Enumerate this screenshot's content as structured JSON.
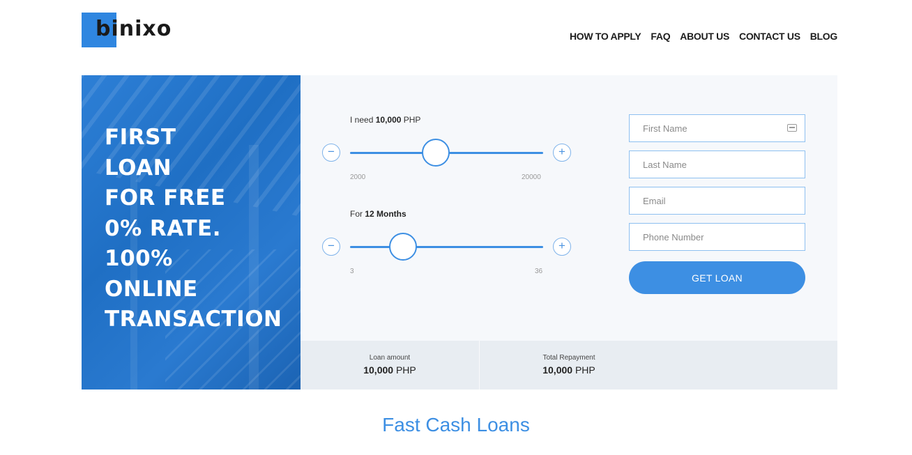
{
  "brand": {
    "logo_text": "binixo",
    "accent_color": "#2f86e0"
  },
  "nav": {
    "items": [
      "HOW TO APPLY",
      "FAQ",
      "ABOUT US",
      "CONTACT US",
      "BLOG"
    ]
  },
  "promo": {
    "lines": [
      "FIRST",
      "LOAN",
      "FOR FREE",
      "0% RATE.",
      "100%",
      "ONLINE",
      "TRANSACTION"
    ]
  },
  "amount_slider": {
    "label_prefix": "I need",
    "value_text": "10,000",
    "unit": "PHP",
    "min": "2000",
    "max": "20000",
    "value": 10000,
    "minus_icon": "minus-icon",
    "plus_icon": "plus-icon"
  },
  "term_slider": {
    "label_prefix": "For",
    "value_text": "12 Months",
    "min": "3",
    "max": "36",
    "value": 12,
    "minus_icon": "minus-icon",
    "plus_icon": "plus-icon"
  },
  "form": {
    "first_name_placeholder": "First Name",
    "last_name_placeholder": "Last Name",
    "email_placeholder": "Email",
    "phone_placeholder": "Phone Number",
    "submit_label": "GET LOAN",
    "field_icon": "id-card-icon"
  },
  "summary": {
    "loan_amount_label": "Loan amount",
    "loan_amount_value": "10,000",
    "loan_amount_unit": "PHP",
    "total_repayment_label": "Total Repayment",
    "total_repayment_value": "10,000",
    "total_repayment_unit": "PHP"
  },
  "section_title": "Fast Cash Loans"
}
